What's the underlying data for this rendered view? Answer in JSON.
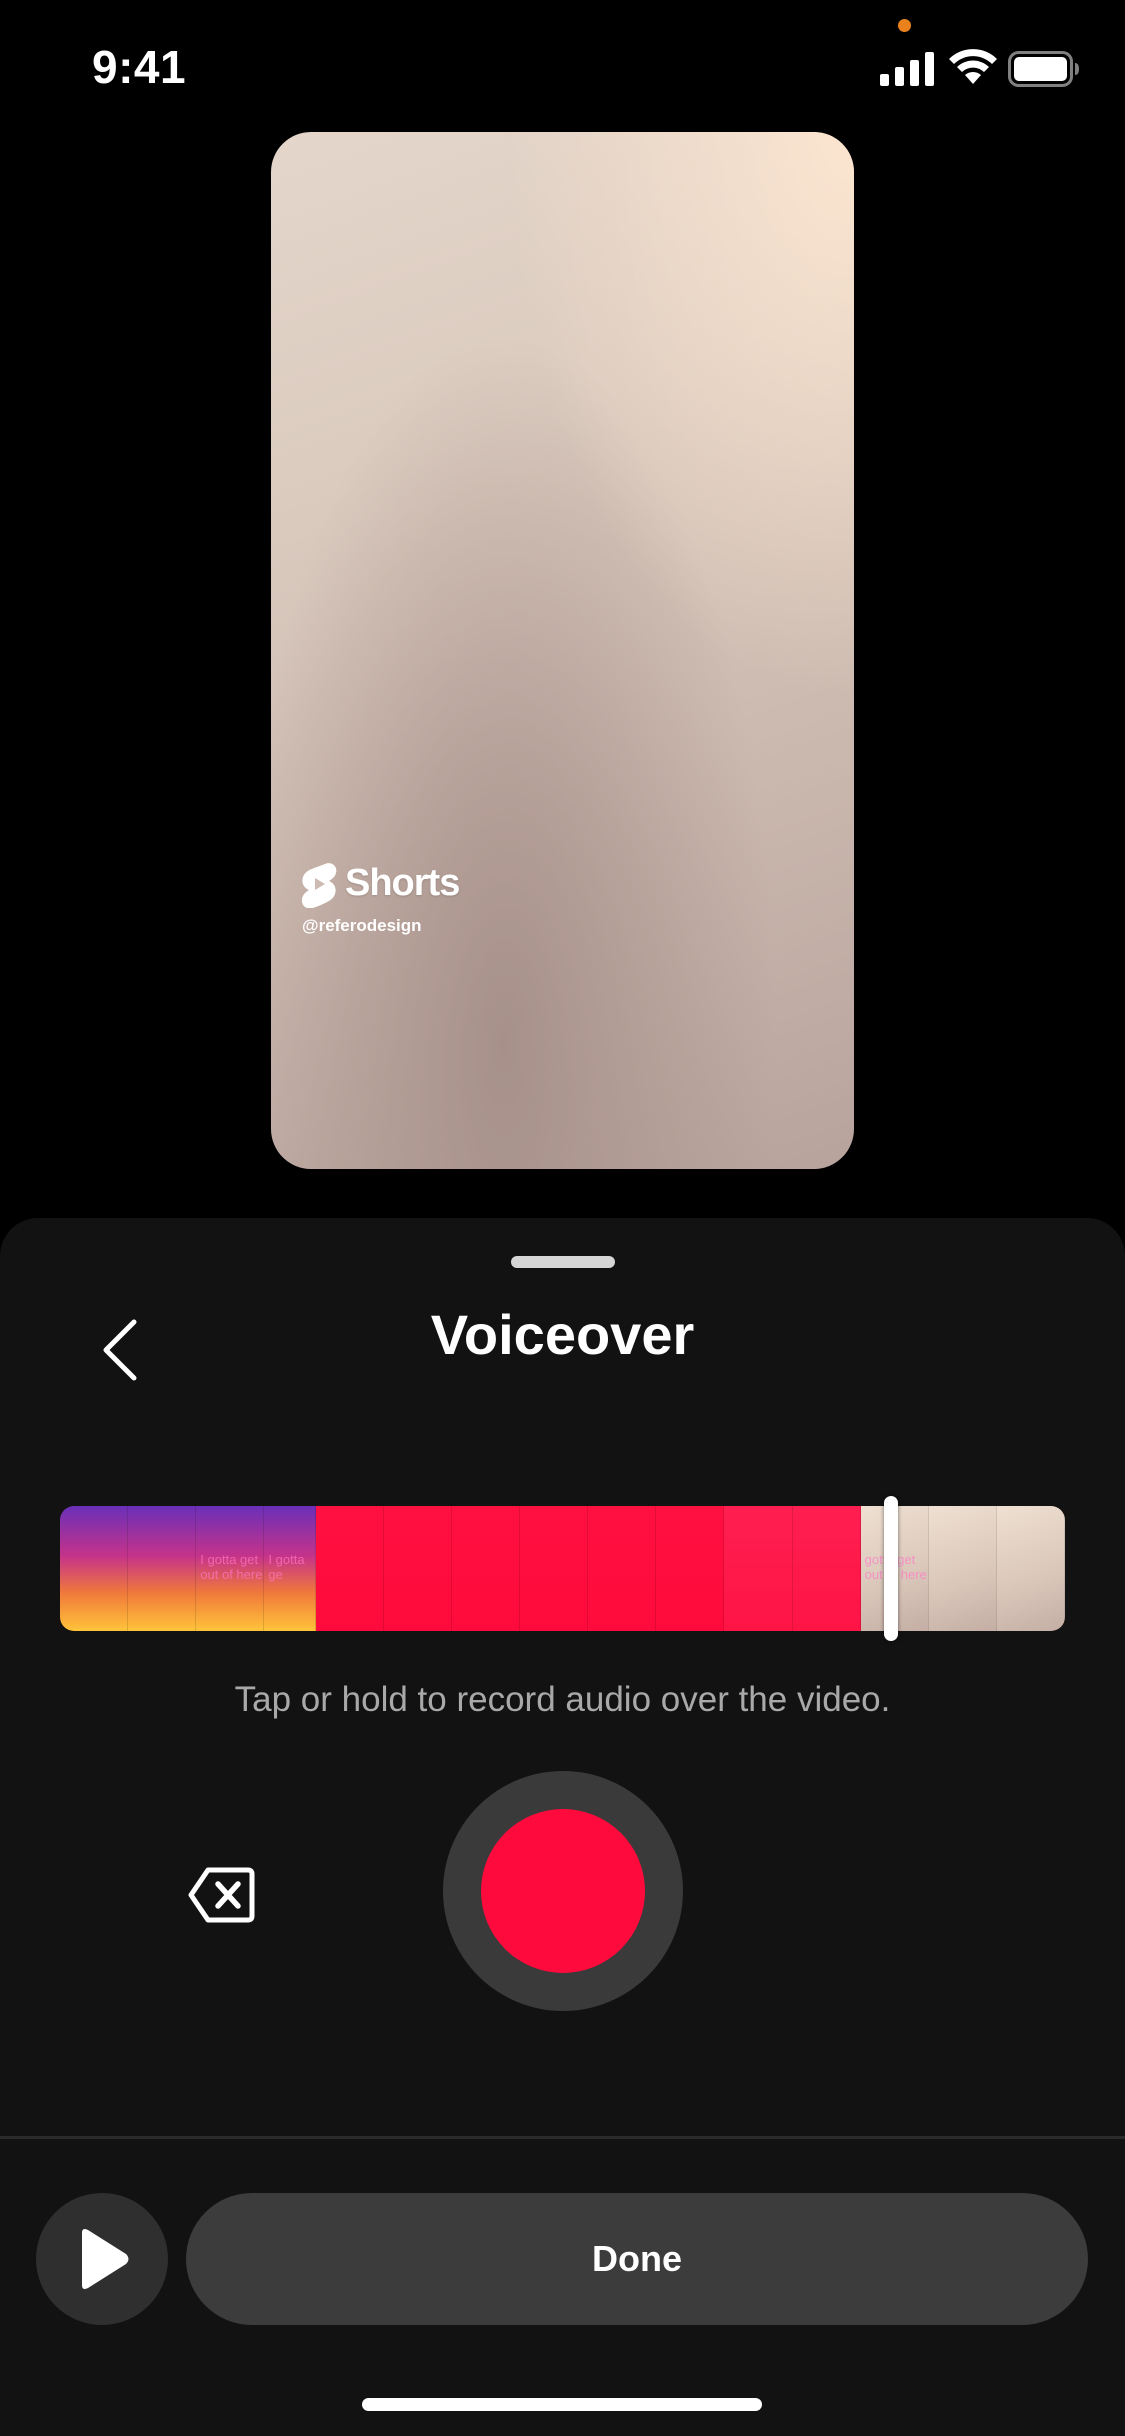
{
  "status_bar": {
    "time": "9:41",
    "privacy_dot_color": "#e9821c"
  },
  "preview": {
    "watermark_brand": "Shorts",
    "watermark_handle": "@referodesign"
  },
  "sheet": {
    "title": "Voiceover",
    "hint": "Tap or hold to record audio over the video.",
    "done_label": "Done"
  },
  "timeline": {
    "playhead_position": 0.82,
    "frames": [
      {
        "style": "warm",
        "text": ""
      },
      {
        "style": "warm",
        "text": ""
      },
      {
        "style": "warm",
        "text": "I gotta get out of here"
      },
      {
        "style": "warm-half",
        "text": "I gotta ge"
      },
      {
        "style": "recorded",
        "text": ""
      },
      {
        "style": "recorded",
        "text": ""
      },
      {
        "style": "recorded",
        "text": ""
      },
      {
        "style": "recorded",
        "text": ""
      },
      {
        "style": "recorded",
        "text": ""
      },
      {
        "style": "recorded",
        "text": ""
      },
      {
        "style": "recorded-light",
        "text": ""
      },
      {
        "style": "recorded-light",
        "text": ""
      },
      {
        "style": "beige",
        "text": "gotta get out of here"
      },
      {
        "style": "beige",
        "text": ""
      },
      {
        "style": "beige",
        "text": ""
      }
    ]
  },
  "colors": {
    "accent_red": "#ff0a3c",
    "sheet_bg": "#121212"
  }
}
